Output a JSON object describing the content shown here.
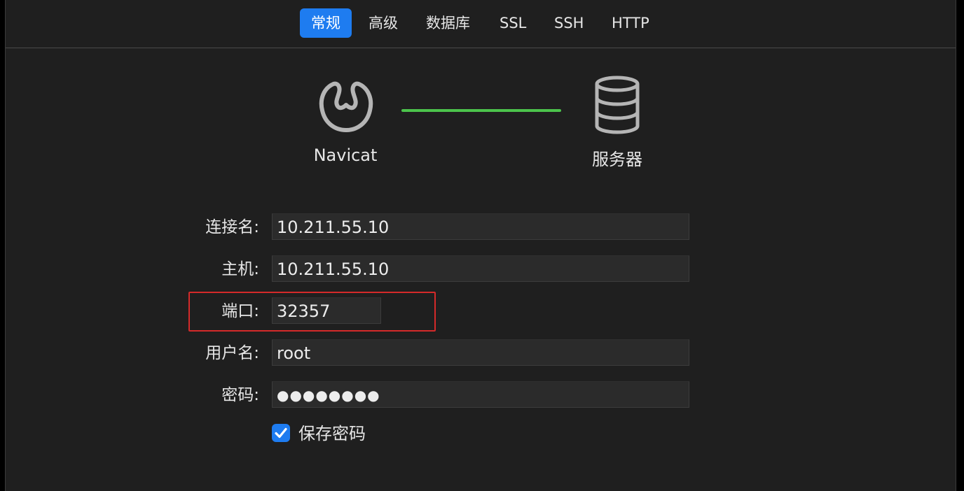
{
  "tabs": [
    {
      "label": "常规",
      "active": true
    },
    {
      "label": "高级",
      "active": false
    },
    {
      "label": "数据库",
      "active": false
    },
    {
      "label": "SSL",
      "active": false
    },
    {
      "label": "SSH",
      "active": false
    },
    {
      "label": "HTTP",
      "active": false
    }
  ],
  "diagram": {
    "client_label": "Navicat",
    "server_label": "服务器",
    "client_icon": "navicat-logo-icon",
    "server_icon": "database-icon",
    "link_color": "#4cc44c"
  },
  "form": {
    "connection_name": {
      "label": "连接名:",
      "value": "10.211.55.10"
    },
    "host": {
      "label": "主机:",
      "value": "10.211.55.10"
    },
    "port": {
      "label": "端口:",
      "value": "32357"
    },
    "username": {
      "label": "用户名:",
      "value": "root"
    },
    "password": {
      "label": "密码:",
      "value": "●●●●●●●●"
    },
    "save_password": {
      "label": "保存密码",
      "checked": true
    }
  },
  "colors": {
    "accent": "#1e7cf0",
    "highlight": "#d42a2a",
    "background": "#1f1f1f"
  }
}
